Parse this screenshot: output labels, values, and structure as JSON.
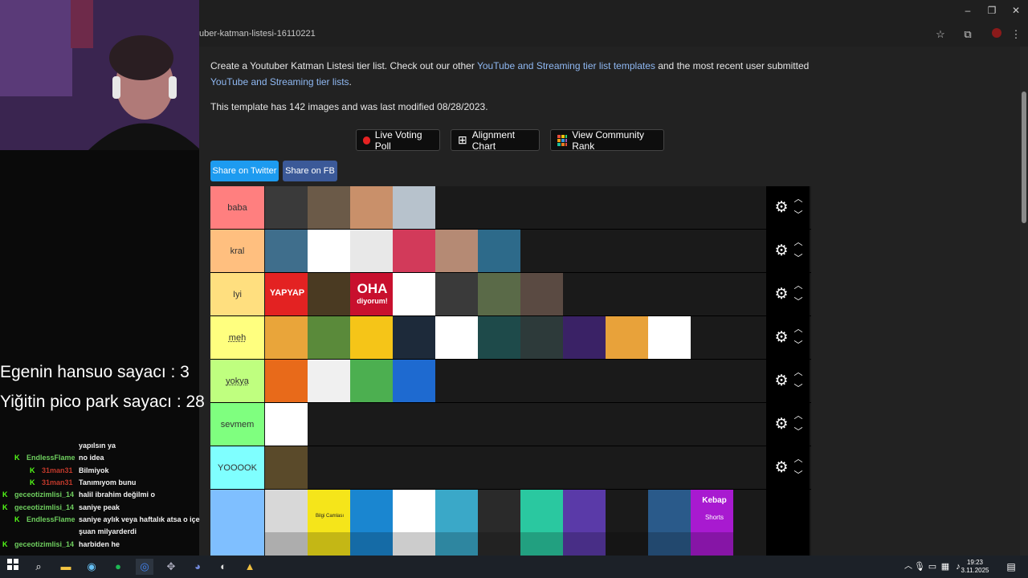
{
  "browser": {
    "url": "uber-katman-listesi-16110221",
    "window_controls": [
      "–",
      "❐",
      "✕"
    ]
  },
  "page": {
    "intro_prefix": "Create a Youtuber Katman Listesi tier list. Check out our other ",
    "intro_link1": "YouTube and Streaming tier list templates",
    "intro_middle": " and the most recent user submitted ",
    "intro_link2": "YouTube and Streaming tier lists",
    "intro_suffix": ".",
    "modified": "This template has 142 images and was last modified 08/28/2023.",
    "buttons": {
      "live_voting": "Live Voting Poll",
      "alignment": "Alignment Chart",
      "community": "View Community Rank"
    },
    "share_twitter": "Share on Twitter",
    "share_fb": "Share on FB"
  },
  "tiers": [
    {
      "label": "baba",
      "color": "#ff7f7f",
      "tiles": [
        "#3a3a3a",
        "#6b5a48",
        "#c9906a",
        "#b7c2cc"
      ]
    },
    {
      "label": "kral",
      "color": "#ffbf7f",
      "tiles": [
        "#3f6e8c",
        "#ffffff",
        "#e8e8e8",
        "#d23a5a",
        "#b58a74",
        "#2d6a8a"
      ]
    },
    {
      "label": "Iyi",
      "color": "#ffdf7f",
      "tiles": [
        "#e32222",
        "#4a3a22",
        "#c8102e",
        "#ffffff",
        "#3a3a3a",
        "#5a6a48",
        "#5a4a42"
      ]
    },
    {
      "label": "meh",
      "color": "#ffff7f",
      "tiles": [
        "#e9a53a",
        "#5a8a3a",
        "#f5c518",
        "#1d2a3a",
        "#ffffff",
        "#1e4a4a",
        "#2d3a3a",
        "#3a2266",
        "#e8a23a",
        "#ffffff"
      ]
    },
    {
      "label": "yokya",
      "color": "#bfff7f",
      "tiles": [
        "#e86a1a",
        "#f0f0f0",
        "#4caf50",
        "#1e6ad0"
      ]
    },
    {
      "label": "sevmem",
      "color": "#7fff7f",
      "tiles": [
        "#ffffff"
      ]
    },
    {
      "label": "YOOOOK",
      "color": "#7fffff",
      "tiles": [
        "#5a4a2a"
      ]
    },
    {
      "label": "",
      "color": "#7fbfff",
      "tiles": [
        "#d8d8d8",
        "#f5e51a",
        "#1a86d0",
        "#ffffff",
        "#3aa8c8",
        "#2a2a2a",
        "#2ac8a0",
        "#5a3aa8",
        "#1a1a1a",
        "#2a5a8a",
        "#a81ad0"
      ]
    }
  ],
  "tile_texts": {
    "yapyap": "YAPYAP",
    "oha": "OHA",
    "diyorum": "diyorum!",
    "bilgi": "Bilgi Camlası",
    "kebap": "Kebap",
    "shorts": "Shorts"
  },
  "stream": {
    "counter1": "Egenin hansuo sayacı : 3",
    "counter2": "Yiğitin pico park sayacı : 28",
    "chat": [
      {
        "user": "",
        "msg": "yapılsın ya",
        "color": "#6fcf5f"
      },
      {
        "user": "EndlessFlame",
        "msg": "no idea",
        "color": "#6fcf5f"
      },
      {
        "user": "31man31",
        "msg": "Bilmiyok",
        "color": "#c0392b"
      },
      {
        "user": "31man31",
        "msg": "Tanımıyom bunu",
        "color": "#c0392b"
      },
      {
        "user": "geceotizimlisi_14",
        "msg": "halil ibrahim değilmi o",
        "color": "#6fcf5f"
      },
      {
        "user": "geceotizimlisi_14",
        "msg": "saniye peak",
        "color": "#6fcf5f"
      },
      {
        "user": "EndlessFlame",
        "msg": "saniye aylık veya haftalık atsa o içe",
        "color": "#6fcf5f"
      },
      {
        "user": "",
        "msg": "şuan milyarderdi",
        "color": "#6fcf5f"
      },
      {
        "user": "geceotizimlisi_14",
        "msg": "harbiden he",
        "color": "#6fcf5f"
      }
    ]
  },
  "taskbar": {
    "time": "19:23",
    "date": "3.11.2025"
  }
}
